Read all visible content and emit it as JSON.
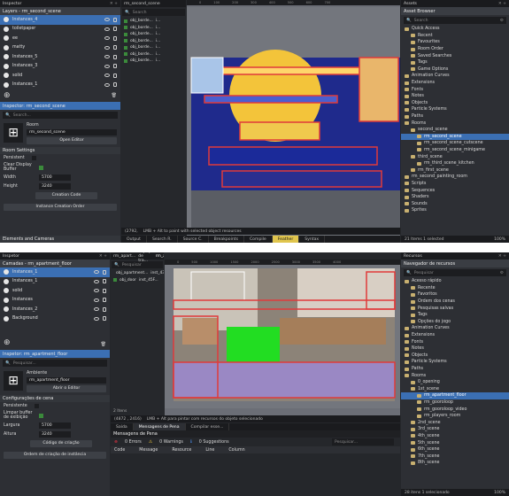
{
  "shot1": {
    "layers_tab": "Layers - rm_second_scene",
    "layers": [
      "Instances_4",
      "toiletpaper",
      "ee",
      "matty",
      "Instances_5",
      "Instances_3",
      "solid",
      "Instances_1"
    ],
    "inspector_tab": "Inspector: rm_second_scene",
    "search_placeholder": "Search...",
    "room_label": "Room",
    "room_name": "rm_second_scene",
    "open_editor": "Open Editor",
    "room_settings": "Room Settings",
    "persistent": "Persistent",
    "clear_display": "Clear Display Buffer",
    "width_label": "Width",
    "width_val": "5700",
    "height_label": "Height",
    "height_val": "3240",
    "creation_code": "Creation Code",
    "instance_order": "Instance Creation Order",
    "elements_cameras": "Elements and Cameras",
    "editor_tab": "rm_second_scene",
    "path_search": "Search",
    "paths": [
      "obj_borde...",
      "obj_borde...",
      "obj_borde...",
      "obj_borde...",
      "obj_borde...",
      "obj_borde...",
      "obj_borde..."
    ],
    "path_values": [
      "i...",
      "i...",
      "i...",
      "i...",
      "i...",
      "i...",
      "i..."
    ],
    "items_count": "7 Items",
    "coord": "(2792,",
    "hint": "LMB + Alt to paint with selected object resources",
    "bottom_tabs": [
      "Output",
      "Search R.",
      "Source C.",
      "Breakpoints",
      "Compile",
      "Feather",
      "Syntax"
    ],
    "assets_tab": "Assets",
    "asset_browser": "Asset Browser",
    "assets": [
      {
        "t": "Quick Access",
        "i": 0,
        "k": "star"
      },
      {
        "t": "Recent",
        "i": 1
      },
      {
        "t": "Favourites",
        "i": 1
      },
      {
        "t": "Room Order",
        "i": 1
      },
      {
        "t": "Saved Searches",
        "i": 1
      },
      {
        "t": "Tags",
        "i": 1
      },
      {
        "t": "Game Options",
        "i": 1
      },
      {
        "t": "Animation Curves",
        "i": 0
      },
      {
        "t": "Extensions",
        "i": 0
      },
      {
        "t": "Fonts",
        "i": 0
      },
      {
        "t": "Notes",
        "i": 0
      },
      {
        "t": "Objects",
        "i": 0
      },
      {
        "t": "Particle Systems",
        "i": 0
      },
      {
        "t": "Paths",
        "i": 0
      },
      {
        "t": "Rooms",
        "i": 0
      },
      {
        "t": "second_scene",
        "i": 1
      },
      {
        "t": "rm_second_scene",
        "i": 2,
        "sel": true
      },
      {
        "t": "rm_second_scene_cutscene",
        "i": 2
      },
      {
        "t": "rm_second_scene_minigame",
        "i": 2
      },
      {
        "t": "third_scene",
        "i": 1
      },
      {
        "t": "rm_third_scene_kitchen",
        "i": 2
      },
      {
        "t": "rm_first_scene",
        "i": 1
      },
      {
        "t": "rm_second_painting_room",
        "i": 0
      },
      {
        "t": "Scripts",
        "i": 0
      },
      {
        "t": "Sequences",
        "i": 0
      },
      {
        "t": "Shaders",
        "i": 0
      },
      {
        "t": "Sounds",
        "i": 0
      },
      {
        "t": "Sprites",
        "i": 0
      }
    ],
    "assets_status": "21 Items  1 selected",
    "zoom": "100% "
  },
  "shot2": {
    "layers_tab": "Inspetor",
    "layers_title": "Camadas - rm_apartment_floor",
    "layers": [
      "Instances_1",
      "Instances_1",
      "solid",
      "Instances",
      "Instances_2",
      "Background"
    ],
    "inspector_tab": "Inspetor: rm_apartment_floor",
    "search_placeholder": "Pesquisar...",
    "room_label": "Ambiente",
    "room_name": "rm_apartment_floor",
    "open_editor": "Abrir o Editor",
    "room_settings": "Configurações de cena",
    "persistent": "Persistente",
    "clear_display": "Limpar buffer de exibição",
    "width_label": "Largura",
    "width_val": "5700",
    "height_label": "Altura",
    "height_val": "3240",
    "creation_code": "Código de criação",
    "instance_order": "Ordem de criação de instância",
    "editor_tabs": [
      "rm_apart...",
      "Espaço de tra...",
      "rm_apart..."
    ],
    "path_search": "Pesquisar",
    "paths": [
      "obj_apartment...",
      "obj_door"
    ],
    "path_values": [
      "inst_438...",
      "inst_45F..."
    ],
    "items_count": "2 Itens",
    "coord": "(4872 , 2416)",
    "hint": "LMB + Alt para pintar com recursos do objeto selecionado",
    "output_tabs": [
      "Saída",
      "Mensagens de Pena",
      "Compilar esse..."
    ],
    "messages_title": "Mensagens de Pena",
    "errors": "0 Errors",
    "warnings": "0 Warnings",
    "suggestions": "0 Suggestions",
    "search_msg": "Pesquisar...",
    "cols": [
      "Code",
      "Message",
      "Resource",
      "Line",
      "Column"
    ],
    "assets_tab": "Recursos",
    "asset_browser": "Navegador de recursos",
    "assets": [
      {
        "t": "Acesso rápido",
        "i": 0
      },
      {
        "t": "Recente",
        "i": 1
      },
      {
        "t": "Favoritos",
        "i": 1
      },
      {
        "t": "Ordem dos cenas",
        "i": 1
      },
      {
        "t": "Pesquisas salvas",
        "i": 1
      },
      {
        "t": "Tags",
        "i": 1
      },
      {
        "t": "Opções do jogo",
        "i": 1
      },
      {
        "t": "Animation Curves",
        "i": 0
      },
      {
        "t": "Extensions",
        "i": 0
      },
      {
        "t": "Fonts",
        "i": 0
      },
      {
        "t": "Notes",
        "i": 0
      },
      {
        "t": "Objects",
        "i": 0
      },
      {
        "t": "Particle Systems",
        "i": 0
      },
      {
        "t": "Paths",
        "i": 0
      },
      {
        "t": "Rooms",
        "i": 0
      },
      {
        "t": "0_opening",
        "i": 1
      },
      {
        "t": "1st_scene",
        "i": 1
      },
      {
        "t": "rm_apartment_floor",
        "i": 2,
        "sel": true
      },
      {
        "t": "rm_gooroloop",
        "i": 2
      },
      {
        "t": "rm_gooroloop_video",
        "i": 2
      },
      {
        "t": "rm_players_room",
        "i": 2
      },
      {
        "t": "2nd_scene",
        "i": 1
      },
      {
        "t": "3rd_scene",
        "i": 1
      },
      {
        "t": "4th_scene",
        "i": 1
      },
      {
        "t": "5th_scene",
        "i": 1
      },
      {
        "t": "6th_scene",
        "i": 1
      },
      {
        "t": "7th_scene",
        "i": 1
      },
      {
        "t": "8th_scene",
        "i": 1
      }
    ],
    "assets_status": "28 itens  1 selecionado",
    "zoom": "100% "
  }
}
